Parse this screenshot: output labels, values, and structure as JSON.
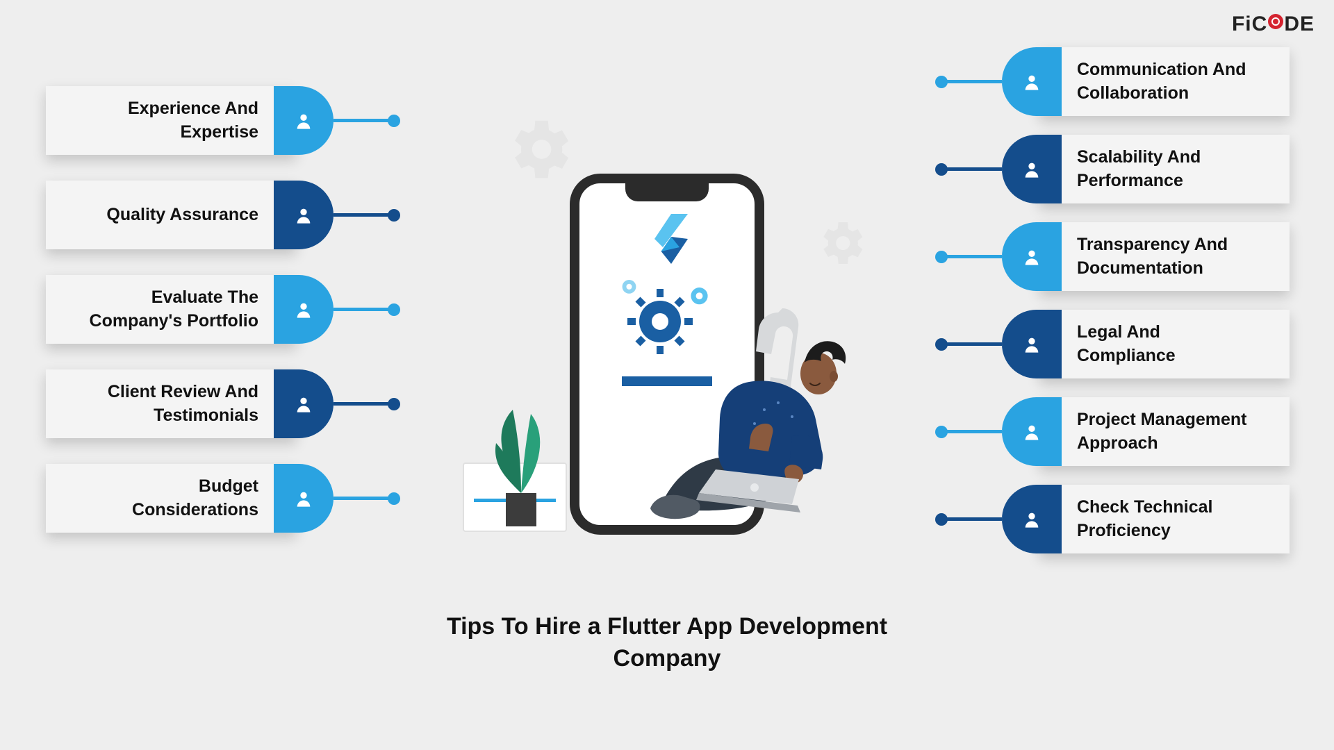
{
  "brand": {
    "text_a": "FiC",
    "text_b": "DE"
  },
  "title": "Tips To Hire a Flutter App Development Company",
  "left": [
    {
      "label": "Experience And Expertise",
      "tone": "light"
    },
    {
      "label": "Quality Assurance",
      "tone": "dark"
    },
    {
      "label": "Evaluate The Company's Portfolio",
      "tone": "light"
    },
    {
      "label": "Client Review And Testimonials",
      "tone": "dark"
    },
    {
      "label": "Budget Considerations",
      "tone": "light"
    }
  ],
  "right": [
    {
      "label": "Communication And Collaboration",
      "tone": "light"
    },
    {
      "label": "Scalability And Performance",
      "tone": "dark"
    },
    {
      "label": "Transparency And Documentation",
      "tone": "light"
    },
    {
      "label": "Legal And Compliance",
      "tone": "dark"
    },
    {
      "label": "Project Management Approach",
      "tone": "light"
    },
    {
      "label": "Check Technical Proficiency",
      "tone": "dark"
    }
  ]
}
